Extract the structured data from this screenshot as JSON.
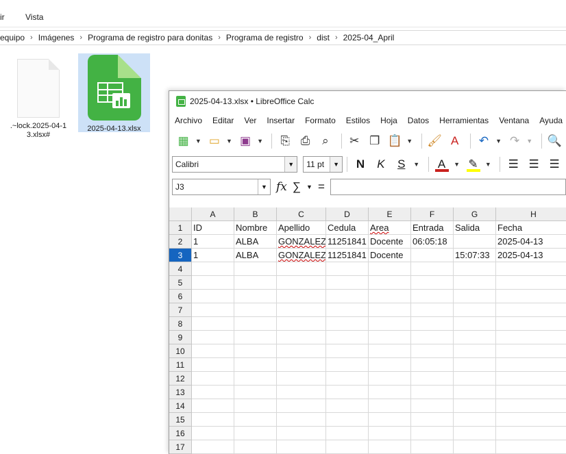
{
  "explorer": {
    "menu": {
      "partial": "ir",
      "view": "Vista"
    },
    "breadcrumb": [
      "equipo",
      "Imágenes",
      "Programa de registro para donitas",
      "Programa de registro",
      "dist",
      "2025-04_April"
    ],
    "files": [
      {
        "name": ".~lock.2025-04-13.xlsx#",
        "name_line1": ".~lock.2025-04-1",
        "name_line2": "3.xlsx#",
        "icon": "document-icon"
      },
      {
        "name": "2025-04-13.xlsx",
        "icon": "calc-spreadsheet-icon",
        "selected": true
      }
    ]
  },
  "calc": {
    "title": "2025-04-13.xlsx • LibreOffice Calc",
    "menu": [
      "Archivo",
      "Editar",
      "Ver",
      "Insertar",
      "Formato",
      "Estilos",
      "Hoja",
      "Datos",
      "Herramientas",
      "Ventana",
      "Ayuda"
    ],
    "font_name": "Calibri",
    "font_size": "11 pt",
    "name_box": "J3",
    "formula": "",
    "columns": [
      "A",
      "B",
      "C",
      "D",
      "E",
      "F",
      "G",
      "H"
    ],
    "row_numbers": [
      "1",
      "2",
      "3",
      "4",
      "5",
      "6",
      "7",
      "8",
      "9",
      "10",
      "11",
      "12",
      "13",
      "14",
      "15",
      "16",
      "17"
    ],
    "active_row": "3",
    "rows": [
      [
        "ID",
        "Nombre",
        "Apellido",
        "Cedula",
        "Area",
        "Entrada",
        "Salida",
        "Fecha"
      ],
      [
        "1",
        "ALBA",
        "GONZALEZ",
        "11251841",
        "Docente",
        "06:05:18",
        "",
        "2025-04-13"
      ],
      [
        "1",
        "ALBA",
        "GONZALEZ",
        "11251841",
        "Docente",
        "",
        "15:07:33",
        "2025-04-13"
      ]
    ],
    "font_color": "#c9211e",
    "highlight_color": "#ffff00",
    "selection_color": "#1565c0"
  }
}
